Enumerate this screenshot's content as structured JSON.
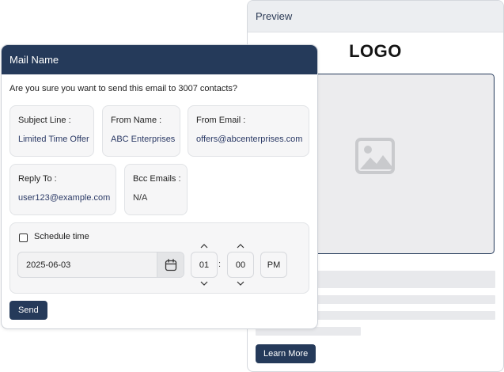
{
  "preview": {
    "title": "Preview",
    "logo_text": "LOGO",
    "cta_label": "Learn More"
  },
  "dialog": {
    "title": "Mail Name",
    "confirm_text": "Are you sure you want to send this email to 3007 contacts?",
    "fields": {
      "subject": {
        "label": "Subject Line :",
        "value": "Limited Time Offer"
      },
      "from_name": {
        "label": "From Name :",
        "value": "ABC Enterprises"
      },
      "from_email": {
        "label": "From Email :",
        "value": "offers@abcenterprises.com"
      },
      "reply_to": {
        "label": "Reply To :",
        "value": "user123@example.com"
      },
      "bcc": {
        "label": "Bcc Emails :",
        "value": "N/A"
      }
    },
    "schedule": {
      "label": "Schedule time",
      "checked": false,
      "date": "2025-06-03",
      "hour": "01",
      "minute": "00",
      "ampm": "PM"
    },
    "send_label": "Send"
  },
  "colors": {
    "brand_navy": "#253a5a",
    "card_bg": "#f6f6f7",
    "value_text": "#2b3a66"
  },
  "icons": [
    "image-placeholder-icon",
    "calendar-icon",
    "chevron-up-icon",
    "chevron-down-icon"
  ]
}
